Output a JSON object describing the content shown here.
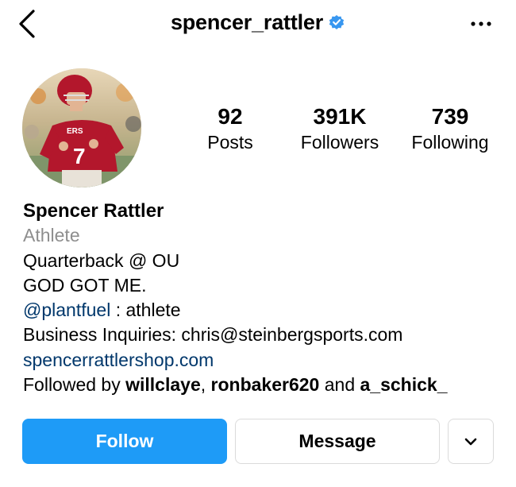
{
  "header": {
    "username": "spencer_rattler",
    "icons": {
      "back": "chevron-left-icon",
      "verified": "verified-badge-icon",
      "more": "more-options-icon"
    },
    "verified_color": "#3897f0"
  },
  "profile": {
    "avatar": "profile-photo"
  },
  "stats": {
    "posts": {
      "value": "92",
      "label": "Posts"
    },
    "followers": {
      "value": "391K",
      "label": "Followers"
    },
    "following": {
      "value": "739",
      "label": "Following"
    }
  },
  "bio": {
    "name": "Spencer Rattler",
    "category": "Athlete",
    "line1": "Quarterback @ OU",
    "line2": "GOD GOT ME.",
    "mention": "@plantfuel",
    "mention_suffix": " : athlete",
    "business": "Business Inquiries: chris@steinbergsports.com",
    "website": "spencerrattlershop.com",
    "followed_by_prefix": "Followed by ",
    "followed_by_users": [
      "willclaye",
      "ronbaker620",
      "a_schick_"
    ],
    "followed_by_sep1": ", ",
    "followed_by_sep2": " and ",
    "link_color": "#00376b",
    "category_color": "#8e8e8e"
  },
  "actions": {
    "follow_label": "Follow",
    "message_label": "Message",
    "dropdown_icon": "chevron-down-icon",
    "follow_color": "#1e9bf7"
  }
}
